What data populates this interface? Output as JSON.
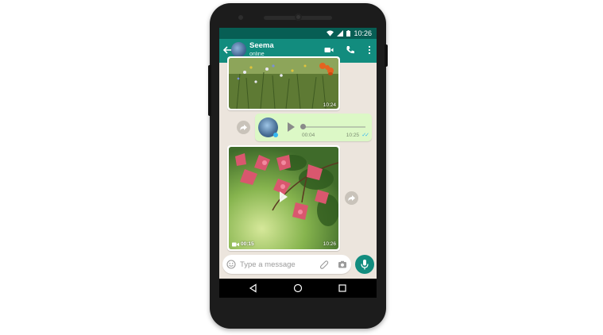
{
  "status_bar": {
    "time": "10:26"
  },
  "chat_header": {
    "contact_name": "Seema",
    "contact_status": "online"
  },
  "messages": {
    "photo_top": {
      "time": "10:24"
    },
    "voice_note": {
      "duration": "00:04",
      "time": "10:25",
      "read_ticks": "✓✓"
    },
    "video": {
      "duration": "00:15",
      "time": "10:26"
    }
  },
  "composer": {
    "placeholder": "Type a message"
  },
  "colors": {
    "header": "#128C7E",
    "status_bar": "#075E54",
    "chat_bg": "#ECE5DD",
    "outgoing_bubble": "#DCF8C6",
    "read_tick": "#34B7F1"
  }
}
